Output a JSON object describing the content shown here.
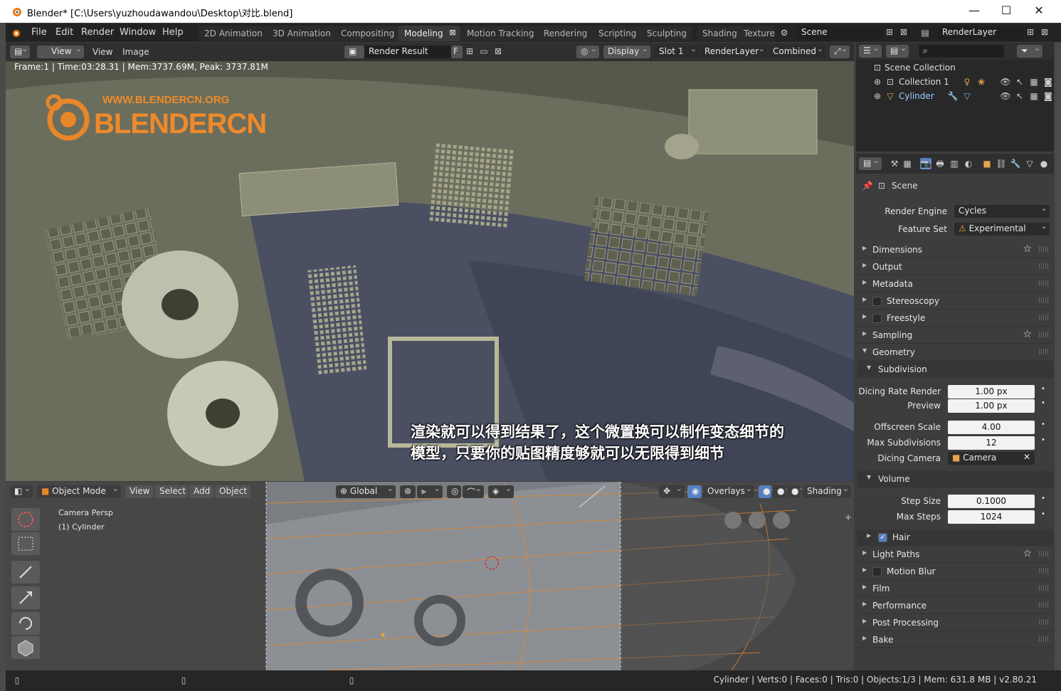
{
  "window": {
    "title": "Blender* [C:\\Users\\yuzhoudawandou\\Desktop\\对比.blend]",
    "min": "—",
    "max": "☐",
    "close": "✕"
  },
  "menu": {
    "file": "File",
    "edit": "Edit",
    "render": "Render",
    "window": "Window",
    "help": "Help"
  },
  "tabs": [
    "2D Animation",
    "3D Animation",
    "Compositing",
    "Modeling",
    "Motion Tracking",
    "Rendering",
    "Scripting",
    "Sculpting",
    "Shading",
    "Texture"
  ],
  "scene": {
    "name": "Scene",
    "renderlayer": "RenderLayer"
  },
  "image_editor": {
    "view": "View",
    "view2": "View",
    "image": "Image",
    "render_result": "Render Result",
    "f": "F",
    "display": "Display",
    "slot": "Slot 1",
    "layer": "RenderLayer",
    "pass": "Combined",
    "status": "Frame:1 | Time:03:28.31 | Mem:3737.69M, Peak: 3737.81M",
    "watermark_url": "WWW.BLENDERCN.ORG",
    "watermark_name": "BLENDERCN"
  },
  "subtitle": {
    "line1": "渲染就可以得到结果了，这个微置换可以制作变态细节的",
    "line2": "模型，只要你的贴图精度够就可以无限得到细节"
  },
  "viewport": {
    "mode": "Object Mode",
    "view": "View",
    "select": "Select",
    "add": "Add",
    "object": "Object",
    "orientation": "Global",
    "overlays": "Overlays",
    "shading": "Shading",
    "camera": "Camera Persp",
    "object_name": "(1) Cylinder"
  },
  "outliner": {
    "scene_collection": "Scene Collection",
    "collection": "Collection 1",
    "cylinder": "Cylinder"
  },
  "properties": {
    "scene": "Scene",
    "render_engine_label": "Render Engine",
    "render_engine": "Cycles",
    "feature_set_label": "Feature Set",
    "feature_set": "Experimental",
    "panels_top": [
      "Dimensions",
      "Output",
      "Metadata",
      "Stereoscopy",
      "Freestyle",
      "Sampling",
      "Geometry"
    ],
    "subdivision": "Subdivision",
    "dicing_rate_render_label": "Dicing Rate Render",
    "dicing_rate_render": "1.00 px",
    "preview_label": "Preview",
    "preview": "1.00 px",
    "offscreen_label": "Offscreen Scale",
    "offscreen": "4.00",
    "max_subdiv_label": "Max Subdivisions",
    "max_subdiv": "12",
    "dicing_camera_label": "Dicing Camera",
    "dicing_camera": "Camera",
    "volume": "Volume",
    "step_size_label": "Step Size",
    "step_size": "0.1000",
    "max_steps_label": "Max Steps",
    "max_steps": "1024",
    "panels_bottom": [
      "Hair",
      "Light Paths",
      "Motion Blur",
      "Film",
      "Performance",
      "Post Processing",
      "Bake"
    ]
  },
  "statusbar": "Cylinder | Verts:0 | Faces:0 | Tris:0 | Objects:1/3 | Mem: 631.8 MB | v2.80.21",
  "colors": {
    "accent": "#e87d0d",
    "selected": "#5680c2",
    "bg": "#3d3d3d"
  }
}
